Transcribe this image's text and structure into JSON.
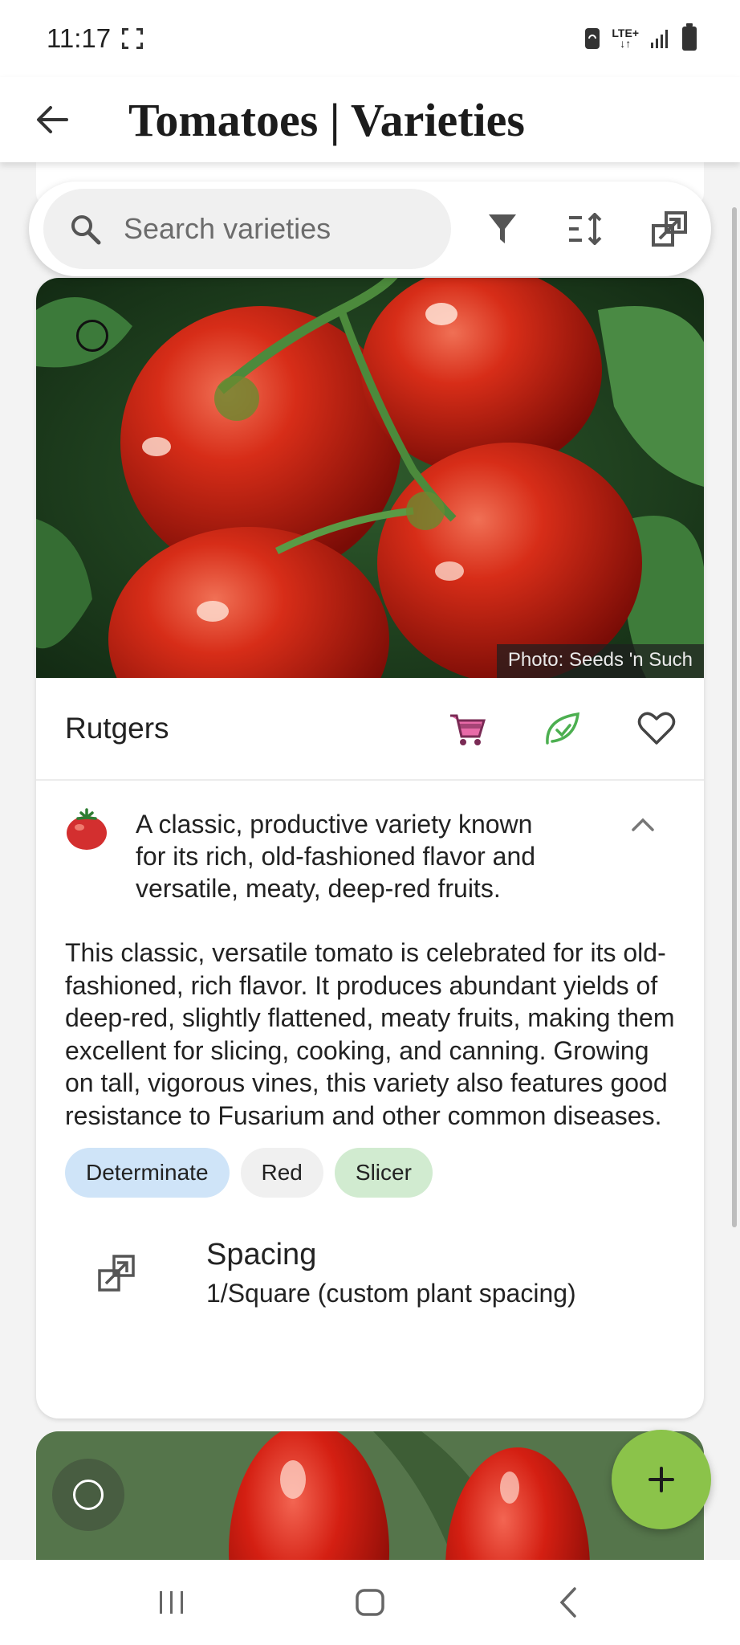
{
  "status_bar": {
    "time": "11:17",
    "network_label": "LTE+",
    "icons": [
      "focus-icon",
      "sync-icon",
      "lte-icon",
      "signal-icon",
      "battery-icon"
    ]
  },
  "app_bar": {
    "title": "Tomatoes | Varieties",
    "back_icon": "arrow-left-icon"
  },
  "search": {
    "placeholder": "Search varieties",
    "tools": [
      "filter-icon",
      "sort-icon",
      "spacing-icon"
    ]
  },
  "card": {
    "photo_credit": "Photo: Seeds 'n Such",
    "name": "Rutgers",
    "actions": [
      "cart-icon",
      "leaf-check-icon",
      "heart-icon"
    ],
    "summary": "A classic, productive variety known for its rich, old-fashioned flavor and versatile, meaty, deep-red fruits.",
    "description": "This classic, versatile tomato is celebrated for its old-fashioned, rich flavor. It produces abundant yields of deep-red, slightly flattened, meaty fruits, making them excellent for slicing, cooking, and canning. Growing on tall, vigorous vines, this variety also features good resistance to Fusarium and other common diseases.",
    "chips": [
      {
        "label": "Determinate",
        "color": "#cfe4f8"
      },
      {
        "label": "Red",
        "color": "#f0f0f0"
      },
      {
        "label": "Slicer",
        "color": "#d1ebd0"
      }
    ],
    "spacing_label": "Spacing",
    "spacing_value": "1/Square (custom plant spacing)"
  },
  "fab": {
    "icon": "plus-icon",
    "color": "#8bc34a"
  },
  "colors": {
    "accent_green": "#8bc34a",
    "cart_pink": "#e86aa8",
    "leaf_green": "#4caf50"
  }
}
